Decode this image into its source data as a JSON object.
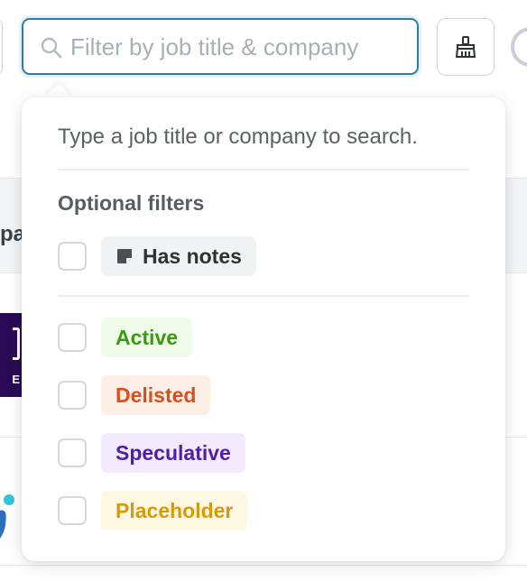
{
  "search": {
    "placeholder": "Filter by job title & company",
    "value": ""
  },
  "toolbar": {
    "clear_icon": "broom-icon"
  },
  "background": {
    "header_fragment": "pa"
  },
  "dropdown": {
    "hint": "Type a job title or company to search.",
    "section_title": "Optional filters",
    "notes_filter": {
      "label": "Has notes",
      "icon": "note-icon",
      "checked": false
    },
    "statuses": [
      {
        "label": "Active",
        "checked": false,
        "color": "#3a9b12",
        "bg": "#f0fcea"
      },
      {
        "label": "Delisted",
        "checked": false,
        "color": "#d8501e",
        "bg": "#fdefe6"
      },
      {
        "label": "Speculative",
        "checked": false,
        "color": "#4f1ea8",
        "bg": "#f3ebfd"
      },
      {
        "label": "Placeholder",
        "checked": false,
        "color": "#d89a0a",
        "bg": "#fff8e2"
      }
    ]
  },
  "colors": {
    "focus_border": "#2c7da0"
  }
}
